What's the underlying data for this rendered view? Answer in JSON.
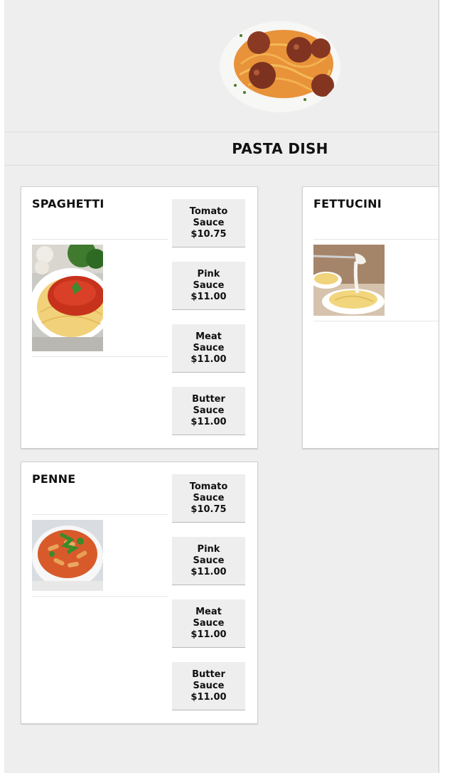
{
  "header": {
    "title": "PASTA DISH",
    "hero_image": "spaghetti-meatballs-photo"
  },
  "menu": [
    {
      "name": "SPAGHETTI",
      "image": "spaghetti-tomato-sauce-photo",
      "options": [
        {
          "sauce": "Tomato",
          "label": "Sauce",
          "price": "$10.75"
        },
        {
          "sauce": "Pink",
          "label": "Sauce",
          "price": "$11.00"
        },
        {
          "sauce": "Meat",
          "label": "Sauce",
          "price": "$11.00"
        },
        {
          "sauce": "Butter",
          "label": "Sauce",
          "price": "$11.00"
        }
      ]
    },
    {
      "name": "FETTUCINI",
      "image": "fettuccine-alfredo-photo",
      "options": []
    },
    {
      "name": "PENNE",
      "image": "penne-pasta-photo",
      "options": [
        {
          "sauce": "Tomato",
          "label": "Sauce",
          "price": "$10.75"
        },
        {
          "sauce": "Pink",
          "label": "Sauce",
          "price": "$11.00"
        },
        {
          "sauce": "Meat",
          "label": "Sauce",
          "price": "$11.00"
        },
        {
          "sauce": "Butter",
          "label": "Sauce",
          "price": "$11.00"
        }
      ]
    }
  ],
  "colors": {
    "page_background": "#eeeeee",
    "card_background": "#ffffff",
    "button_background": "#eeeeee",
    "text": "#111111"
  }
}
